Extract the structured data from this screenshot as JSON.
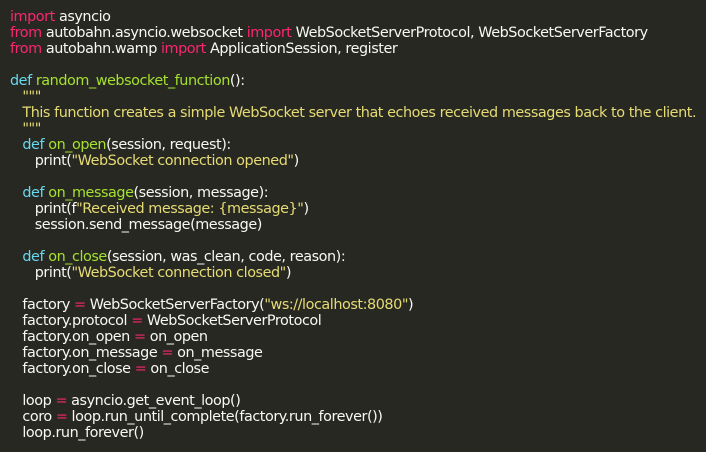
{
  "editor": {
    "theme": {
      "background": "#272822",
      "foreground": "#f8f8f2",
      "keyword": "#f92672",
      "def_keyword": "#66d9ef",
      "function_name": "#a6e22e",
      "string": "#e6db74"
    },
    "lines": [
      {
        "indent": 0,
        "tokens": [
          {
            "t": "kw",
            "v": "import"
          },
          {
            "t": "plain",
            "v": " asyncio"
          }
        ]
      },
      {
        "indent": 0,
        "tokens": [
          {
            "t": "kw",
            "v": "from"
          },
          {
            "t": "plain",
            "v": " autobahn.asyncio.websocket "
          },
          {
            "t": "kw",
            "v": "import"
          },
          {
            "t": "plain",
            "v": " WebSocketServerProtocol, WebSocketServerFactory"
          }
        ]
      },
      {
        "indent": 0,
        "tokens": [
          {
            "t": "kw",
            "v": "from"
          },
          {
            "t": "plain",
            "v": " autobahn.wamp "
          },
          {
            "t": "kw",
            "v": "import"
          },
          {
            "t": "plain",
            "v": " ApplicationSession, register"
          }
        ]
      },
      {
        "indent": 0,
        "tokens": []
      },
      {
        "indent": 0,
        "tokens": [
          {
            "t": "def",
            "v": "def"
          },
          {
            "t": "plain",
            "v": " "
          },
          {
            "t": "fn",
            "v": "random_websocket_function"
          },
          {
            "t": "plain",
            "v": "():"
          }
        ]
      },
      {
        "indent": 1,
        "tokens": [
          {
            "t": "str",
            "v": "\"\"\""
          }
        ]
      },
      {
        "indent": 1,
        "tokens": [
          {
            "t": "str",
            "v": "This function creates a simple WebSocket server that echoes received messages back to the client."
          }
        ]
      },
      {
        "indent": 1,
        "tokens": [
          {
            "t": "str",
            "v": "\"\"\""
          }
        ]
      },
      {
        "indent": 1,
        "tokens": [
          {
            "t": "def",
            "v": "def"
          },
          {
            "t": "plain",
            "v": " "
          },
          {
            "t": "fn",
            "v": "on_open"
          },
          {
            "t": "plain",
            "v": "(session, request):"
          }
        ]
      },
      {
        "indent": 2,
        "tokens": [
          {
            "t": "plain",
            "v": "print("
          },
          {
            "t": "str",
            "v": "\"WebSocket connection opened\""
          },
          {
            "t": "plain",
            "v": ")"
          }
        ]
      },
      {
        "indent": 0,
        "tokens": []
      },
      {
        "indent": 1,
        "tokens": [
          {
            "t": "def",
            "v": "def"
          },
          {
            "t": "plain",
            "v": " "
          },
          {
            "t": "fn",
            "v": "on_message"
          },
          {
            "t": "plain",
            "v": "(session, message):"
          }
        ]
      },
      {
        "indent": 2,
        "tokens": [
          {
            "t": "plain",
            "v": "print("
          },
          {
            "t": "plain",
            "v": "f"
          },
          {
            "t": "str",
            "v": "\"Received message: {message}\""
          },
          {
            "t": "plain",
            "v": ")"
          }
        ]
      },
      {
        "indent": 2,
        "tokens": [
          {
            "t": "plain",
            "v": "session.send_message(message)"
          }
        ]
      },
      {
        "indent": 0,
        "tokens": []
      },
      {
        "indent": 1,
        "tokens": [
          {
            "t": "def",
            "v": "def"
          },
          {
            "t": "plain",
            "v": " "
          },
          {
            "t": "fn",
            "v": "on_close"
          },
          {
            "t": "plain",
            "v": "(session, was_clean, code, reason):"
          }
        ]
      },
      {
        "indent": 2,
        "tokens": [
          {
            "t": "plain",
            "v": "print("
          },
          {
            "t": "str",
            "v": "\"WebSocket connection closed\""
          },
          {
            "t": "plain",
            "v": ")"
          }
        ]
      },
      {
        "indent": 0,
        "tokens": []
      },
      {
        "indent": 1,
        "tokens": [
          {
            "t": "plain",
            "v": "factory "
          },
          {
            "t": "kw",
            "v": "="
          },
          {
            "t": "plain",
            "v": " WebSocketServerFactory("
          },
          {
            "t": "str",
            "v": "\"ws://localhost:8080\""
          },
          {
            "t": "plain",
            "v": ")"
          }
        ]
      },
      {
        "indent": 1,
        "tokens": [
          {
            "t": "plain",
            "v": "factory.protocol "
          },
          {
            "t": "kw",
            "v": "="
          },
          {
            "t": "plain",
            "v": " WebSocketServerProtocol"
          }
        ]
      },
      {
        "indent": 1,
        "tokens": [
          {
            "t": "plain",
            "v": "factory.on_open "
          },
          {
            "t": "kw",
            "v": "="
          },
          {
            "t": "plain",
            "v": " on_open"
          }
        ]
      },
      {
        "indent": 1,
        "tokens": [
          {
            "t": "plain",
            "v": "factory.on_message "
          },
          {
            "t": "kw",
            "v": "="
          },
          {
            "t": "plain",
            "v": " on_message"
          }
        ]
      },
      {
        "indent": 1,
        "tokens": [
          {
            "t": "plain",
            "v": "factory.on_close "
          },
          {
            "t": "kw",
            "v": "="
          },
          {
            "t": "plain",
            "v": " on_close"
          }
        ]
      },
      {
        "indent": 0,
        "tokens": []
      },
      {
        "indent": 1,
        "tokens": [
          {
            "t": "plain",
            "v": "loop "
          },
          {
            "t": "kw",
            "v": "="
          },
          {
            "t": "plain",
            "v": " asyncio.get_event_loop()"
          }
        ]
      },
      {
        "indent": 1,
        "tokens": [
          {
            "t": "plain",
            "v": "coro "
          },
          {
            "t": "kw",
            "v": "="
          },
          {
            "t": "plain",
            "v": " loop.run_until_complete(factory.run_forever())"
          }
        ]
      },
      {
        "indent": 1,
        "tokens": [
          {
            "t": "plain",
            "v": "loop.run_forever()"
          }
        ]
      }
    ]
  }
}
